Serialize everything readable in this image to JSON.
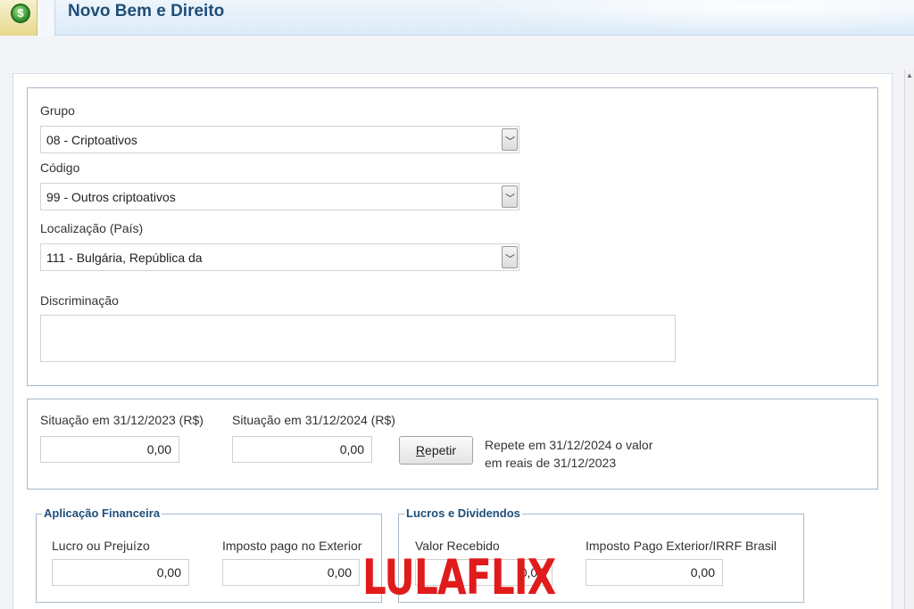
{
  "window": {
    "title": "Novo Bem e Direito"
  },
  "form": {
    "grupo_label": "Grupo",
    "grupo_value": "08 - Criptoativos",
    "codigo_label": "Código",
    "codigo_value": "99 - Outros criptoativos",
    "localizacao_label": "Localização (País)",
    "localizacao_value": "111 - Bulgária, República da",
    "discriminacao_label": "Discriminação",
    "discriminacao_value": ""
  },
  "situacao": {
    "label_2023": "Situação em 31/12/2023 (R$)",
    "value_2023": "0,00",
    "label_2024": "Situação em 31/12/2024 (R$)",
    "value_2024": "0,00",
    "repeat_button_first": "R",
    "repeat_button_rest": "epetir",
    "repeat_hint_line1": "Repete em 31/12/2024 o valor",
    "repeat_hint_line2": "em reais de 31/12/2023"
  },
  "aplicacao": {
    "title": "Aplicação Financeira",
    "lucro_label": "Lucro ou Prejuízo",
    "lucro_value": "0,00",
    "imposto_label": "Imposto pago no Exterior",
    "imposto_value": "0,00"
  },
  "lucros": {
    "title": "Lucros e Dividendos",
    "valor_label": "Valor Recebido",
    "valor_value": "0,00",
    "imposto_label": "Imposto Pago Exterior/IRRF Brasil",
    "imposto_value": "0,00"
  },
  "watermark": "LULAFLIX"
}
